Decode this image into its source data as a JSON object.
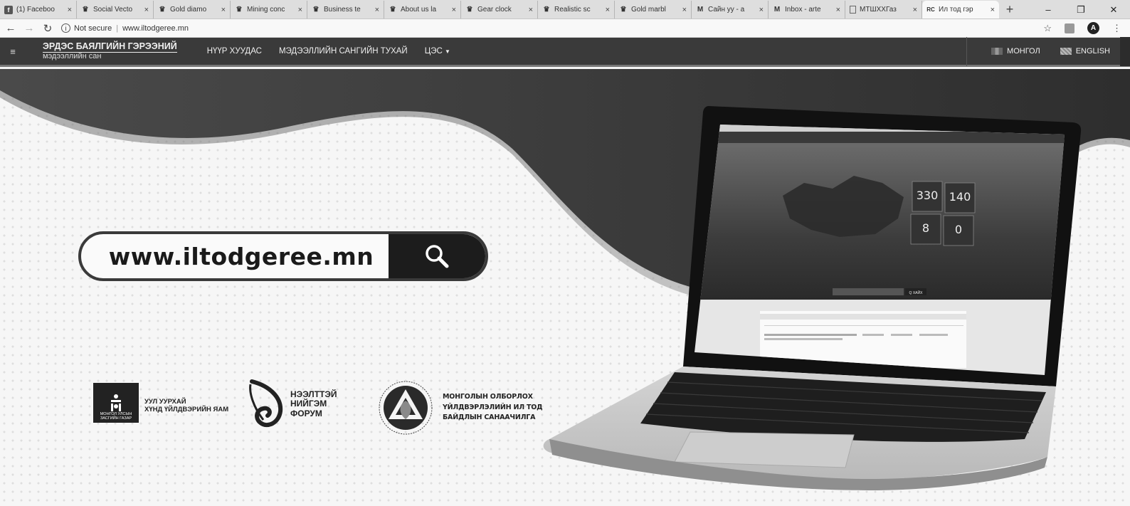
{
  "browser": {
    "tabs": [
      {
        "icon": "facebook-icon",
        "label": "(1) Faceboo"
      },
      {
        "icon": "crown-icon",
        "label": "Social Vecto"
      },
      {
        "icon": "crown-icon",
        "label": "Gold diamo"
      },
      {
        "icon": "crown-icon",
        "label": "Mining conc"
      },
      {
        "icon": "crown-icon",
        "label": "Business te"
      },
      {
        "icon": "crown-icon",
        "label": "About us la"
      },
      {
        "icon": "crown-icon",
        "label": "Gear clock"
      },
      {
        "icon": "crown-icon",
        "label": "Realistic sc"
      },
      {
        "icon": "crown-icon",
        "label": "Gold marbl"
      },
      {
        "icon": "gmail-icon",
        "label": "Сайн уу - a"
      },
      {
        "icon": "gmail-icon",
        "label": "Inbox - arte"
      },
      {
        "icon": "page-icon",
        "label": "МТШХХГаз"
      },
      {
        "icon": "rc-icon",
        "label": "Ил тод гэр"
      }
    ],
    "active_tab": 12,
    "new_tab": "+",
    "security": "Not secure",
    "url": "www.iltodgeree.mn",
    "avatar_letter": "A"
  },
  "header": {
    "brand_title": "ЭРДЭС БАЯЛГИЙН ГЭРЭЭНИЙ",
    "brand_subtitle": "мэдээллийн сан",
    "nav": [
      "НҮҮР ХУУДАС",
      "МЭДЭЭЛЛИЙН САНГИЙН ТУХАЙ",
      "ЦЭС"
    ],
    "lang_mn": "МОНГОЛ",
    "lang_en": "ENGLISH"
  },
  "hero": {
    "search_url": "www.iltodgeree.mn",
    "laptop_stats": [
      "330",
      "140",
      "8",
      "0"
    ],
    "laptop_search_btn": "Q ХАЙХ"
  },
  "logos": {
    "ministry_seal_text": "МОНГОЛ УЛСЫН ЗАСГИЙН ГАЗАР",
    "ministry_line1": "УУЛ УУРХАЙ",
    "ministry_line2": "ХҮНД ҮЙЛДВЭРИЙН ЯАМ",
    "forum_line1": "НЭЭЛТТЭЙ",
    "forum_line2": "НИЙГЭМ",
    "forum_line3": "ФОРУМ",
    "eiti_line1": "МОНГОЛЫН ОЛБОРЛОХ",
    "eiti_line2": "ҮЙЛДВЭРЛЭЛИЙН ИЛ ТОД",
    "eiti_line3": "БАЙДЛЫН САНААЧИЛГА"
  }
}
